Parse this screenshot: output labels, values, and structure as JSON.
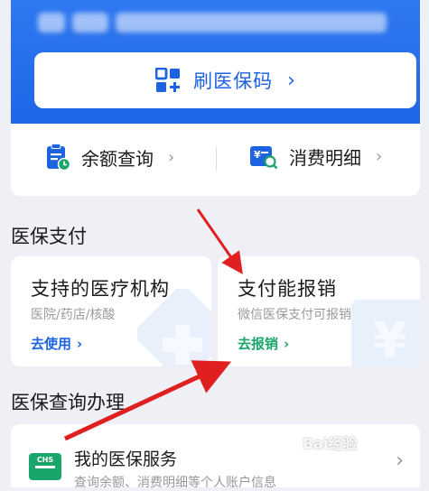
{
  "header": {
    "scan_label": "刷医保码"
  },
  "quick_actions": [
    {
      "label": "余额查询"
    },
    {
      "label": "消费明细"
    }
  ],
  "section_payment": {
    "title": "医保支付",
    "cards": [
      {
        "title": "支持的医疗机构",
        "subtitle": "医院/药店/核酸",
        "link": "去使用",
        "link_color": "#1d62e0"
      },
      {
        "title": "支付能报销",
        "subtitle": "微信医保支付可报销",
        "link": "去报销",
        "link_color": "#1aa56a"
      }
    ]
  },
  "section_query": {
    "title": "医保查询办理",
    "service_title": "我的医保服务",
    "service_subtitle": "查询余额、消费明细等个人账户信息",
    "badge_text": "CHS"
  },
  "watermark": "Bai经验",
  "colors": {
    "brand_blue": "#1d62e0",
    "green": "#1aa56a",
    "arrow_red": "#e02020"
  }
}
